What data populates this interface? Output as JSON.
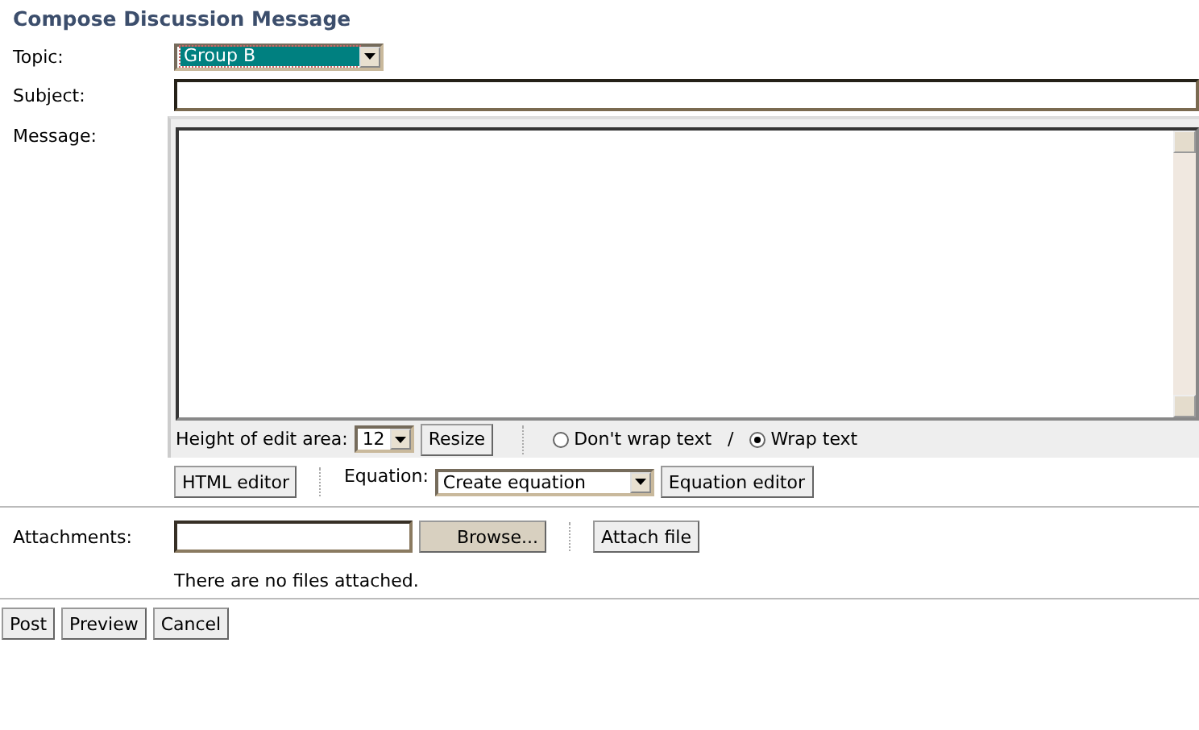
{
  "title": "Compose Discussion Message",
  "topic": {
    "label": "Topic:",
    "value": "Group B"
  },
  "subject": {
    "label": "Subject:"
  },
  "message": {
    "label": "Message:",
    "height_label": "Height of edit area:",
    "height_value": "12",
    "resize": "Resize",
    "wrap_options": [
      {
        "label": "Don't wrap text",
        "selected": false
      },
      {
        "label": "Wrap text",
        "selected": true
      }
    ],
    "wrap_separator": "/"
  },
  "editor_bar": {
    "html_editor": "HTML editor",
    "equation_label": "Equation:",
    "equation_value": "Create equation",
    "equation_editor": "Equation editor"
  },
  "attachments": {
    "label": "Attachments:",
    "browse": "Browse...",
    "attach": "Attach file",
    "note": "There are no files attached."
  },
  "buttons": [
    "Post",
    "Preview",
    "Cancel"
  ]
}
